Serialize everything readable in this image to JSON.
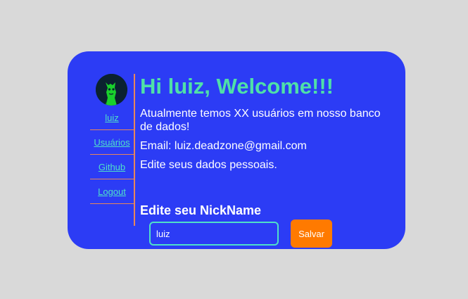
{
  "sidebar": {
    "avatar_icon": "user-avatar",
    "items": [
      {
        "label": "luiz"
      },
      {
        "label": "Usuários"
      },
      {
        "label": "Github"
      },
      {
        "label": "Logout"
      }
    ]
  },
  "main": {
    "title": "Hi luiz, Welcome!!!",
    "users_text": "Atualmente temos XX usuários em nosso banco de dados!",
    "email_text": "Email: luiz.deadzone@gmail.com",
    "edit_text": "Edite seus dados pessoais.",
    "nick_heading": "Edite seu NickName",
    "nick_value": "luiz",
    "save_label": "Salvar"
  },
  "colors": {
    "card": "#2c3cf5",
    "accent": "#4fe0a8",
    "link": "#4fe0c8",
    "divider": "#e9865a",
    "button": "#ff7a00"
  }
}
